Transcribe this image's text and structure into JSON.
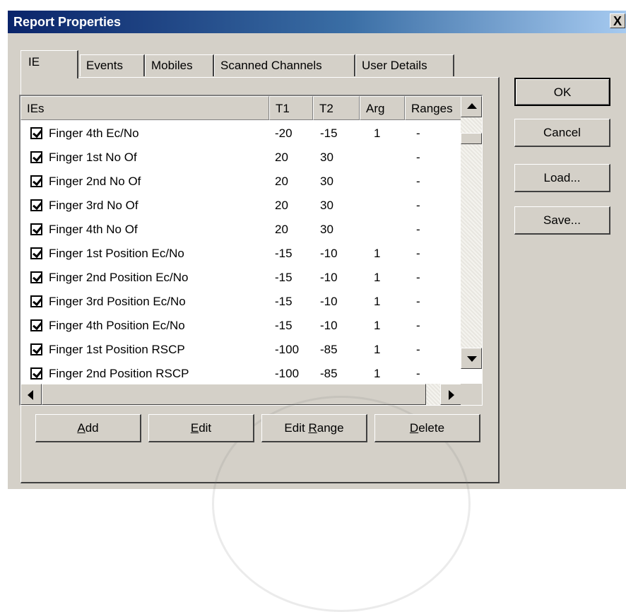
{
  "window": {
    "title": "Report Properties",
    "close_glyph": "X"
  },
  "tabs": [
    {
      "label": "IE",
      "active": true
    },
    {
      "label": "Events"
    },
    {
      "label": "Mobiles"
    },
    {
      "label": "Scanned Channels"
    },
    {
      "label": "User Details"
    }
  ],
  "list": {
    "columns": [
      "IEs",
      "T1",
      "T2",
      "Arg",
      "Ranges"
    ],
    "rows": [
      {
        "checked": true,
        "ie": "Finger 4th Ec/No",
        "t1": "-20",
        "t2": "-15",
        "arg": "1",
        "ranges": "-"
      },
      {
        "checked": true,
        "ie": "Finger 1st No Of",
        "t1": "20",
        "t2": "30",
        "arg": "",
        "ranges": "-"
      },
      {
        "checked": true,
        "ie": "Finger 2nd No Of",
        "t1": "20",
        "t2": "30",
        "arg": "",
        "ranges": "-"
      },
      {
        "checked": true,
        "ie": "Finger 3rd No Of",
        "t1": "20",
        "t2": "30",
        "arg": "",
        "ranges": "-"
      },
      {
        "checked": true,
        "ie": "Finger 4th No Of",
        "t1": "20",
        "t2": "30",
        "arg": "",
        "ranges": "-"
      },
      {
        "checked": true,
        "ie": "Finger 1st Position Ec/No",
        "t1": "-15",
        "t2": "-10",
        "arg": "1",
        "ranges": "-"
      },
      {
        "checked": true,
        "ie": "Finger 2nd Position Ec/No",
        "t1": "-15",
        "t2": "-10",
        "arg": "1",
        "ranges": "-"
      },
      {
        "checked": true,
        "ie": "Finger 3rd Position Ec/No",
        "t1": "-15",
        "t2": "-10",
        "arg": "1",
        "ranges": "-"
      },
      {
        "checked": true,
        "ie": "Finger 4th Position Ec/No",
        "t1": "-15",
        "t2": "-10",
        "arg": "1",
        "ranges": "-"
      },
      {
        "checked": true,
        "ie": "Finger 1st Position RSCP",
        "t1": "-100",
        "t2": "-85",
        "arg": "1",
        "ranges": "-"
      },
      {
        "checked": true,
        "ie": "Finger 2nd Position RSCP",
        "t1": "-100",
        "t2": "-85",
        "arg": "1",
        "ranges": "-"
      }
    ]
  },
  "bottom_buttons": {
    "add": {
      "pre": "",
      "key": "A",
      "post": "dd"
    },
    "edit": {
      "pre": "",
      "key": "E",
      "post": "dit"
    },
    "edit_range": {
      "pre": "Edit ",
      "key": "R",
      "post": "ange"
    },
    "delete": {
      "pre": "",
      "key": "D",
      "post": "elete"
    }
  },
  "side_buttons": {
    "ok": "OK",
    "cancel": "Cancel",
    "load": "Load...",
    "save": "Save..."
  }
}
